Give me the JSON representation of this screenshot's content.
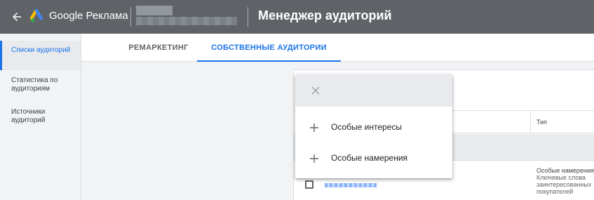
{
  "header": {
    "back_icon": "arrow-back-icon",
    "logo_icon": "google-ads-logo-icon",
    "brand": "Google Реклама",
    "account_hidden": true,
    "title": "Менеджер аудиторий",
    "background": "#5f6368"
  },
  "sidebar": {
    "items": [
      {
        "label": "Списки аудиторий",
        "active": true
      },
      {
        "label": "Статистика по аудиториям",
        "active": false
      },
      {
        "label": "Источники аудиторий",
        "active": false
      }
    ]
  },
  "tabs": [
    {
      "label": "РЕМАРКЕТИНГ",
      "active": false
    },
    {
      "label": "СОБСТВЕННЫЕ АУДИТОРИИ",
      "active": true
    }
  ],
  "table": {
    "columns": [
      "Тип"
    ],
    "rows": [
      {
        "name_hidden": true,
        "type": "Особые намерения",
        "type_detail": "Ключевые слова заинтересованных покупателей"
      }
    ]
  },
  "menu": {
    "close_icon": "close-icon",
    "items": [
      {
        "icon": "plus-icon",
        "label": "Особые интересы"
      },
      {
        "icon": "plus-icon",
        "label": "Особые намерения"
      }
    ]
  },
  "colors": {
    "accent": "#1a73e8",
    "header_bg": "#5f6368",
    "sidebar_bg": "#f1f3f4",
    "logo_blue": "#4285f4",
    "logo_yellow": "#fbbc04",
    "logo_green": "#34a853"
  }
}
